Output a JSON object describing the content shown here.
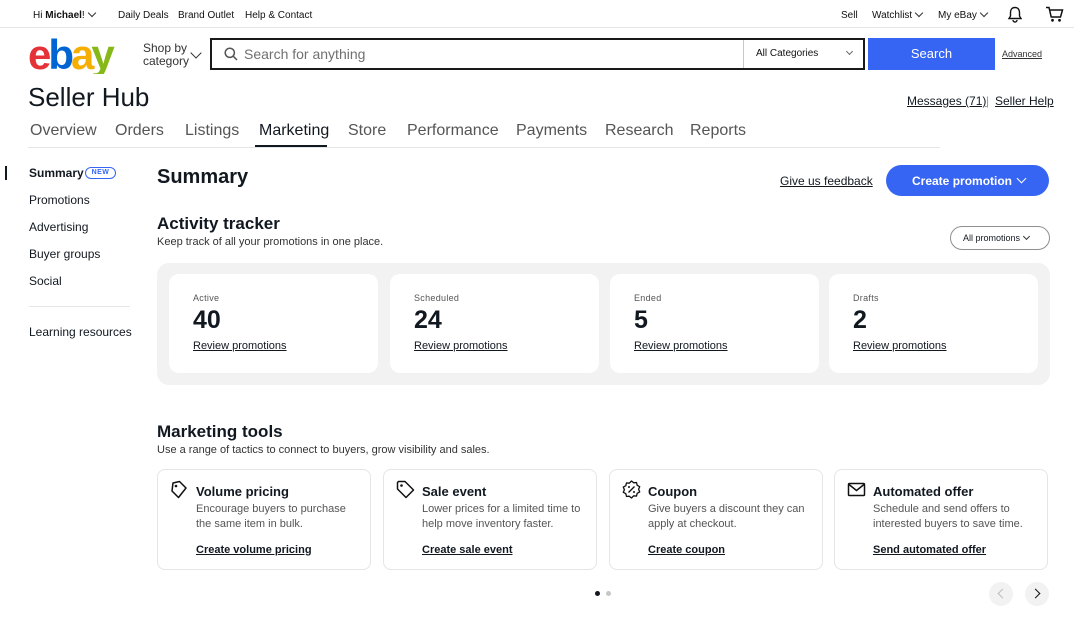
{
  "topbar": {
    "greeting_prefix": "Hi ",
    "user": "Michael",
    "greeting_suffix": "!",
    "links": [
      "Daily Deals",
      "Brand Outlet",
      "Help & Contact"
    ],
    "sell": "Sell",
    "watchlist": "Watchlist",
    "myebay": "My eBay"
  },
  "header": {
    "logo_letters": [
      "e",
      "b",
      "a",
      "y"
    ],
    "logo_colors": [
      "#e53238",
      "#0064d2",
      "#f5af02",
      "#86b817"
    ],
    "shop_by_line1": "Shop by",
    "shop_by_line2": "category",
    "search_placeholder": "Search for anything",
    "category": "All Categories",
    "search_button": "Search",
    "advanced": "Advanced"
  },
  "hub": {
    "title": "Seller Hub",
    "messages": "Messages (71)",
    "separator": "|",
    "seller_help": "Seller Help"
  },
  "tabs": [
    "Overview",
    "Orders",
    "Listings",
    "Marketing",
    "Store",
    "Performance",
    "Payments",
    "Research",
    "Reports"
  ],
  "active_tab": "Marketing",
  "leftnav": {
    "items": [
      "Summary",
      "Promotions",
      "Advertising",
      "Buyer groups",
      "Social"
    ],
    "new_badge": "NEW",
    "learning": "Learning resources"
  },
  "summary": {
    "title": "Summary",
    "feedback": "Give us feedback",
    "create_promotion": "Create promotion"
  },
  "activity": {
    "title": "Activity tracker",
    "subtitle": "Keep track of all your promotions in one place.",
    "filter": "All promotions",
    "cards": [
      {
        "label": "Active",
        "count": "40",
        "link": "Review promotions"
      },
      {
        "label": "Scheduled",
        "count": "24",
        "link": "Review promotions"
      },
      {
        "label": "Ended",
        "count": "5",
        "link": "Review promotions"
      },
      {
        "label": "Drafts",
        "count": "2",
        "link": "Review promotions"
      }
    ]
  },
  "tools": {
    "title": "Marketing tools",
    "subtitle": "Use a range of tactics to connect to buyers, grow visibility and sales.",
    "items": [
      {
        "icon": "volume-pricing-tag-icon",
        "title": "Volume pricing",
        "desc": "Encourage buyers to purchase the same item in bulk.",
        "action": "Create volume pricing"
      },
      {
        "icon": "sale-tag-icon",
        "title": "Sale event",
        "desc": "Lower prices for a limited time to help move inventory faster.",
        "action": "Create sale event"
      },
      {
        "icon": "coupon-badge-icon",
        "title": "Coupon",
        "desc": "Give buyers a discount they can apply at checkout.",
        "action": "Create coupon"
      },
      {
        "icon": "envelope-icon",
        "title": "Automated offer",
        "desc": "Schedule and send offers to interested buyers to save time.",
        "action": "Send automated offer"
      }
    ]
  },
  "colors": {
    "primary": "#3665f3",
    "text": "#111820",
    "tracker_bg": "#f2f2f2"
  }
}
